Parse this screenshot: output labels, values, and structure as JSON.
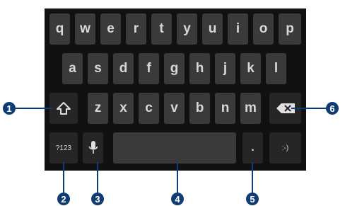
{
  "keyboard": {
    "row1": [
      "q",
      "w",
      "e",
      "r",
      "t",
      "y",
      "u",
      "i",
      "o",
      "p"
    ],
    "row2": [
      "a",
      "s",
      "d",
      "f",
      "g",
      "h",
      "j",
      "k",
      "l"
    ],
    "row3": [
      "z",
      "x",
      "c",
      "v",
      "b",
      "n",
      "m"
    ],
    "symbols_label": "?123",
    "period_label": ".",
    "enter_label": ":-)"
  },
  "callouts": [
    "1",
    "2",
    "3",
    "4",
    "5",
    "6"
  ],
  "colors": {
    "keyboard_bg": "#111111",
    "key_bg": "#3a3a3a",
    "callout": "#0f3d73"
  },
  "icons": {
    "shift": "shift-arrow-icon",
    "mic": "microphone-icon",
    "delete": "backspace-icon"
  }
}
